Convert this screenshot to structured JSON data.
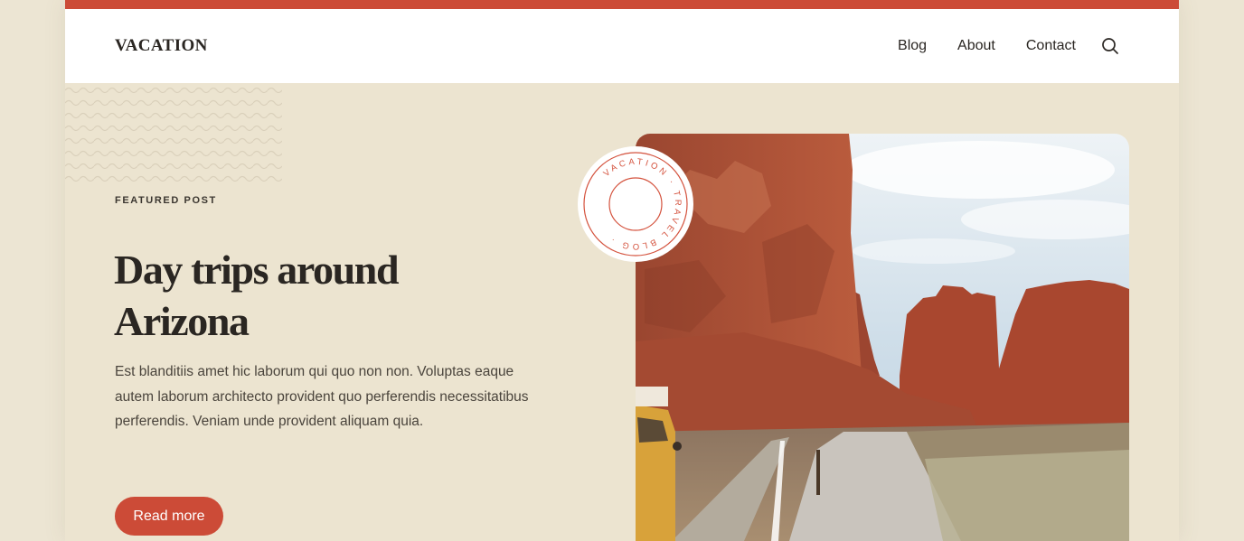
{
  "site": {
    "title": "VACATION"
  },
  "nav": {
    "items": [
      {
        "label": "Blog"
      },
      {
        "label": "About"
      },
      {
        "label": "Contact"
      }
    ],
    "search_icon": "search-icon"
  },
  "hero": {
    "eyebrow": "FEATURED POST",
    "title": "Day trips around Arizona",
    "excerpt": "Est blanditiis amet hic laborum qui quo non non. Voluptas eaque autem laborum architecto provident quo perferendis necessitatibus perferendis. Veniam unde provident aliquam quia.",
    "cta_label": "Read more"
  },
  "badge": {
    "text": "VACATION · TRAVEL BLOG ·"
  },
  "colors": {
    "accent": "#cc4b37",
    "background": "#ece4d0",
    "header_bg": "#ffffff",
    "text": "#2a2622"
  }
}
